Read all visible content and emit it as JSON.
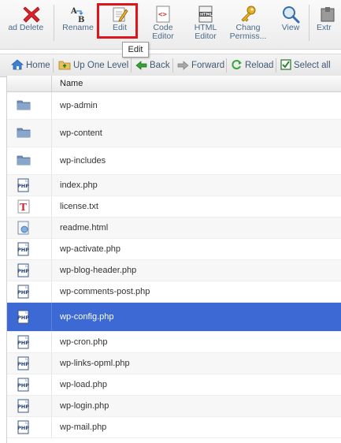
{
  "toolbar": {
    "items": [
      {
        "label": "ad",
        "icon": "download-icon"
      },
      {
        "label": "Delete",
        "icon": "delete-icon"
      },
      {
        "label": "Rename",
        "icon": "rename-icon"
      },
      {
        "label": "Edit",
        "icon": "edit-icon"
      },
      {
        "label": "Code Editor",
        "icon": "code-editor-icon"
      },
      {
        "label": "HTML Editor",
        "icon": "html-editor-icon"
      },
      {
        "label": "Chang Permiss...",
        "icon": "permissions-icon"
      },
      {
        "label": "View",
        "icon": "view-icon"
      },
      {
        "label": "Extr",
        "icon": "extract-icon"
      }
    ],
    "tooltip": "Edit"
  },
  "nav": {
    "home": "Home",
    "up_one_level": "Up One Level",
    "back": "Back",
    "forward": "Forward",
    "reload": "Reload",
    "select_all": "Select all"
  },
  "list": {
    "header_name": "Name",
    "files": [
      {
        "name": "wp-admin",
        "type": "folder"
      },
      {
        "name": "wp-content",
        "type": "folder"
      },
      {
        "name": "wp-includes",
        "type": "folder"
      },
      {
        "name": "index.php",
        "type": "php"
      },
      {
        "name": "license.txt",
        "type": "text"
      },
      {
        "name": "readme.html",
        "type": "html"
      },
      {
        "name": "wp-activate.php",
        "type": "php"
      },
      {
        "name": "wp-blog-header.php",
        "type": "php"
      },
      {
        "name": "wp-comments-post.php",
        "type": "php"
      },
      {
        "name": "wp-config.php",
        "type": "php",
        "selected": true
      },
      {
        "name": "wp-cron.php",
        "type": "php"
      },
      {
        "name": "wp-links-opml.php",
        "type": "php"
      },
      {
        "name": "wp-load.php",
        "type": "php"
      },
      {
        "name": "wp-login.php",
        "type": "php"
      },
      {
        "name": "wp-mail.php",
        "type": "php"
      }
    ]
  },
  "colors": {
    "selected_row": "#3d69d4",
    "highlight_box": "#e0141d",
    "toolbar_label": "#4a6b8a"
  }
}
